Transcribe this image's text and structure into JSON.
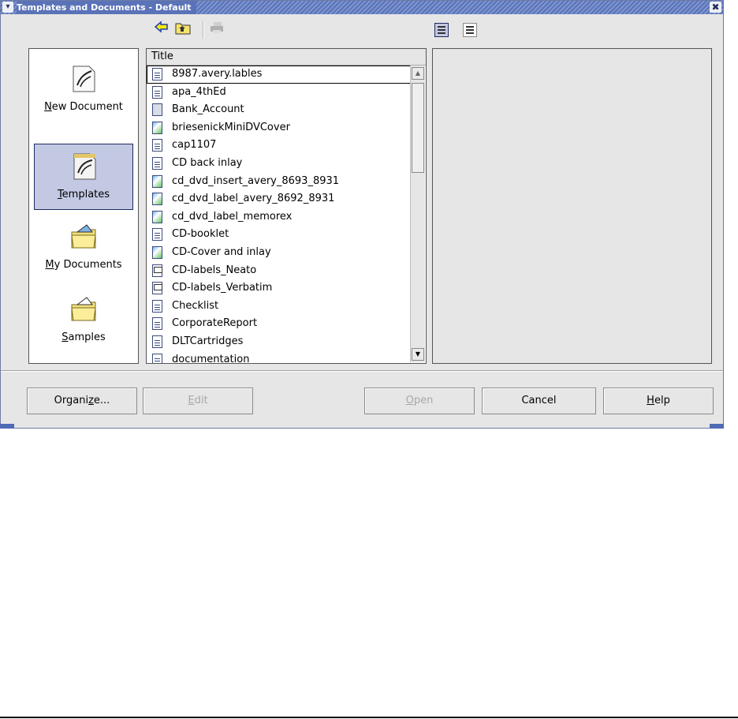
{
  "window": {
    "title": "Templates and Documents - Default",
    "menu_glyph": "▾",
    "close_glyph": "✖"
  },
  "toolbar": {
    "back_icon": "arrow-left-icon",
    "up_icon": "folder-up-icon",
    "print_icon": "print-icon",
    "view_icons": [
      "list-view-icon",
      "detail-view-icon"
    ]
  },
  "places": [
    {
      "label": "New Document",
      "accel": "N",
      "icon": "new-document-icon",
      "selected": false
    },
    {
      "label": "Templates",
      "accel": "T",
      "icon": "templates-icon",
      "selected": true
    },
    {
      "label": "My Documents",
      "accel": "M",
      "icon": "my-documents-folder-icon",
      "selected": false
    },
    {
      "label": "Samples",
      "accel": "S",
      "icon": "samples-folder-icon",
      "selected": false
    }
  ],
  "filelist": {
    "column_title": "Title",
    "items": [
      {
        "name": "8987.avery.lables",
        "type": "writer"
      },
      {
        "name": "apa_4thEd",
        "type": "writer"
      },
      {
        "name": "Bank_Account",
        "type": "calc"
      },
      {
        "name": "briesenickMiniDVCover",
        "type": "draw"
      },
      {
        "name": "cap1107",
        "type": "writer"
      },
      {
        "name": "CD back inlay",
        "type": "writer"
      },
      {
        "name": "cd_dvd_insert_avery_8693_8931",
        "type": "draw"
      },
      {
        "name": "cd_dvd_label_avery_8692_8931",
        "type": "draw"
      },
      {
        "name": "cd_dvd_label_memorex",
        "type": "draw"
      },
      {
        "name": "CD-booklet",
        "type": "writer"
      },
      {
        "name": "CD-Cover and inlay",
        "type": "draw"
      },
      {
        "name": "CD-labels_Neato",
        "type": "impress"
      },
      {
        "name": "CD-labels_Verbatim",
        "type": "impress"
      },
      {
        "name": "Checklist",
        "type": "writer"
      },
      {
        "name": "CorporateReport",
        "type": "writer"
      },
      {
        "name": "DLTCartridges",
        "type": "writer"
      },
      {
        "name": "documentation",
        "type": "writer"
      }
    ]
  },
  "buttons": {
    "organize": {
      "pre": "Organi",
      "accel": "z",
      "post": "e..."
    },
    "edit": {
      "pre": "",
      "accel": "E",
      "post": "dit"
    },
    "open": {
      "pre": "",
      "accel": "O",
      "post": "pen"
    },
    "cancel": {
      "pre": "Cancel",
      "accel": "",
      "post": ""
    },
    "help": {
      "pre": "",
      "accel": "H",
      "post": "elp"
    }
  },
  "colors": {
    "titlebar": "#5a73b8",
    "selection": "#c3c9e3",
    "dialog_bg": "#e6e6e6"
  }
}
